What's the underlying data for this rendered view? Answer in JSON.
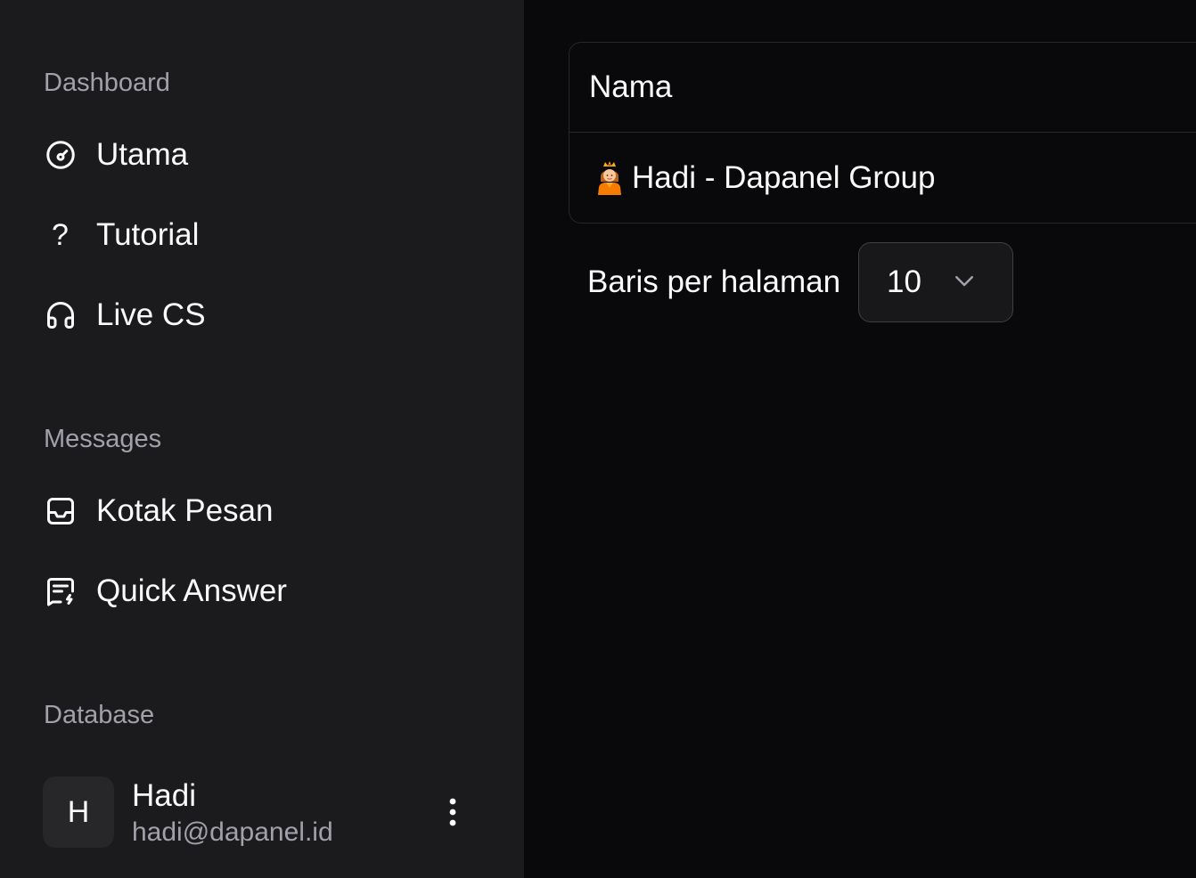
{
  "sidebar": {
    "sections": [
      {
        "label": "Dashboard",
        "items": [
          {
            "label": "Utama",
            "icon": "gauge-icon"
          },
          {
            "label": "Tutorial",
            "icon": "question-mark-icon"
          },
          {
            "label": "Live CS",
            "icon": "headset-icon"
          }
        ]
      },
      {
        "label": "Messages",
        "items": [
          {
            "label": "Kotak Pesan",
            "icon": "inbox-icon"
          },
          {
            "label": "Quick Answer",
            "icon": "message-lightning-icon"
          }
        ]
      },
      {
        "label": "Database",
        "items": []
      }
    ],
    "user": {
      "initial": "H",
      "name": "Hadi",
      "email": "hadi@dapanel.id",
      "menu_icon": "more-vertical-icon"
    },
    "qmark": "?"
  },
  "main": {
    "table": {
      "header": "Nama",
      "rows": [
        {
          "emoji": "princess-emoji",
          "text": "Hadi - Dapanel Group"
        }
      ]
    },
    "pagination": {
      "label": "Baris per halaman",
      "value": "10",
      "icon": "chevron-down-icon"
    }
  },
  "colors": {
    "sidebar_bg": "#1b1b1e",
    "main_bg": "#09090b",
    "muted_text": "#a1a1aa",
    "border": "#27272a"
  }
}
